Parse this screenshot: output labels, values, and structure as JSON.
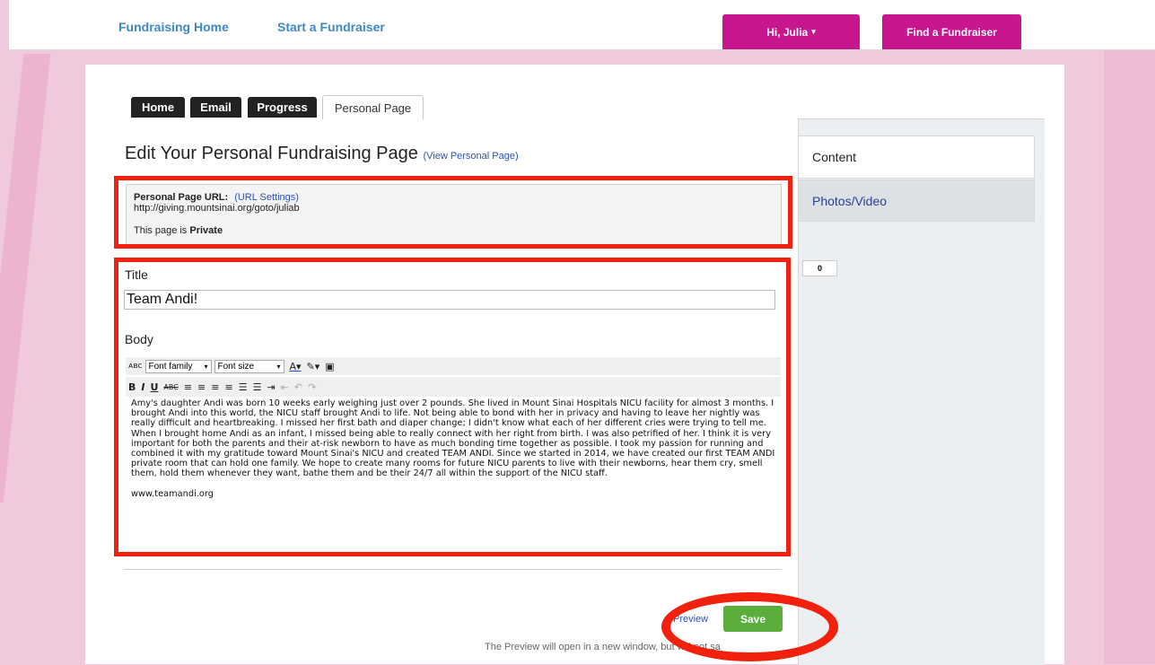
{
  "nav": {
    "home": "Fundraising Home",
    "start": "Start a Fundraiser",
    "greeting": "Hi, Julia",
    "find": "Find a Fundraiser"
  },
  "tabs": [
    "Home",
    "Email",
    "Progress",
    "Personal Page"
  ],
  "heading": {
    "title": "Edit Your Personal Fundraising Page",
    "view_link": "(View Personal Page)"
  },
  "info": {
    "url_label": "Personal Page URL:",
    "url_settings": "(URL Settings)",
    "url": "http://giving.mountsinai.org/goto/juliab",
    "privacy_prefix": "This page is",
    "privacy_value": "Private"
  },
  "form": {
    "title_label": "Title",
    "title_value": "Team Andi!",
    "body_label": "Body"
  },
  "toolbar": {
    "font_family": "Font family",
    "font_size": "Font size"
  },
  "body_text": {
    "para1": "Amy's daughter Andi was born 10 weeks early weighing just over 2 pounds. She lived in Mount Sinai Hospitals NICU facility for almost 3 months. I brought Andi into this world, the NICU staff brought Andi to life. Not being able to bond with her in privacy and having to leave her nightly was really difficult and heartbreaking. I missed her first bath and diaper change; I didn't know what each of her different cries were trying to tell me. When I brought home Andi as an infant, I missed being able to really connect with her right from birth. I was also petrified of her. I think it is very important for both the parents and their at-risk newborn to have as much bonding time together as possible. I took my passion for running and combined it with my gratitude toward Mount Sinai's NICU and created TEAM ANDI. Since we started in 2014, we have created our first TEAM ANDI private room that can hold one family. We hope to create many rooms for future NICU parents to live with their newborns, hear them cry, smell them, hold them whenever they want, bathe them and be their 24/7 all within the support of the NICU staff.",
    "para2": "www.teamandi.org"
  },
  "sidebar": {
    "content": "Content",
    "photos": "Photos/Video",
    "count": "0"
  },
  "actions": {
    "preview": "Preview",
    "save": "Save",
    "note": "The Preview will open in a new window, but will not sa"
  },
  "colors": {
    "accent_pink": "#c8168f",
    "link_blue": "#3f88c7",
    "save_green": "#5cae3c",
    "annotation_red": "#f2210d"
  }
}
